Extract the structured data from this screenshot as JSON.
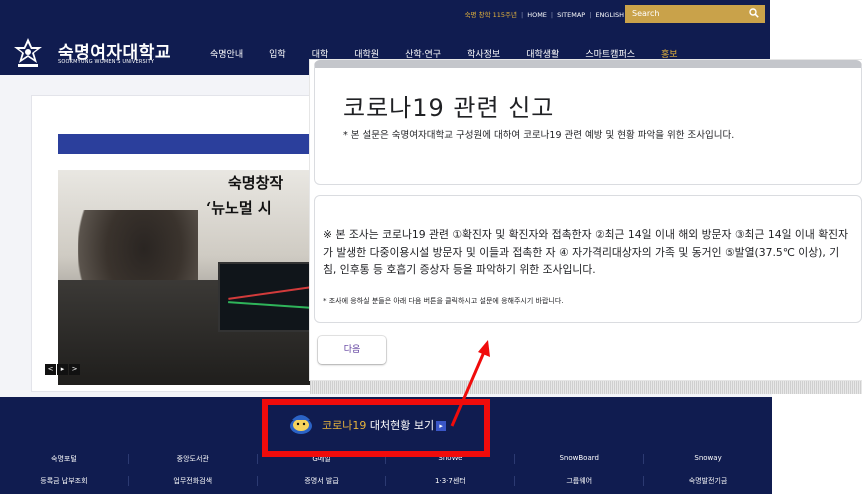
{
  "site": {
    "toplinks": {
      "anniversary": "숙명 창학 115주년",
      "home": "HOME",
      "sitemap": "SITEMAP",
      "english": "ENGLISH"
    },
    "search_placeholder": "Search",
    "logo_ko": "숙명여자대학교",
    "logo_en": "SOOKMYUNG WOMEN'S UNIVERSITY",
    "nav": [
      "숙명안내",
      "입학",
      "대학",
      "대학원",
      "산학·연구",
      "학사정보",
      "대학생활",
      "스마트캠퍼스",
      "홍보"
    ],
    "hero_title": "숙명창작",
    "hero_sub": "‘뉴노멀 시",
    "slider": {
      "prev": "<",
      "play": "▸",
      "next": ">"
    },
    "corona": {
      "prefix": "코로나19",
      "suffix": " 대처현황 보기",
      "arrow": "▸"
    },
    "quick_row1": [
      "숙명포털",
      "중앙도서관",
      "G메일",
      "SnoWe",
      "SnowBoard",
      "Snoway"
    ],
    "quick_row2": [
      "등록금 납부조회",
      "업무전화검색",
      "증명서 발급",
      "1·3·7센터",
      "그룹웨어",
      "숙명발전기금"
    ]
  },
  "form": {
    "title": "코로나19 관련 신고",
    "description": "* 본 설문은 숙명여자대학교 구성원에 대하여 코로나19 관련 예방 및 현황 파악을 위한 조사입니다.",
    "notice": "※ 본 조사는 코로나19 관련 ①확진자 및 확진자와 접촉한자 ②최근 14일 이내 해외 방문자 ③최근 14일 이내 확진자가 발생한 다중이용시설 방문자 및 이들과 접촉한 자 ④ 자가격리대상자의 가족 및 동거인 ⑤발열(37.5℃ 이상), 기침, 인후통 등 호흡기 증상자 등을 파악하기 위한 조사입니다.",
    "small_note": "* 조사에 응하실 분들은 아래 다음 버튼을 클릭하시고 설문에 응해주시기 바랍니다.",
    "next_button": "다음"
  },
  "colors": {
    "navy": "#101c50",
    "gold": "#e6b43c",
    "highlight_red": "#f00b0b",
    "button_text": "#5b3a9c"
  },
  "icons": [
    "search-icon",
    "logo-emblem-icon",
    "mascot-icon",
    "arrow-right-icon",
    "play-icon"
  ]
}
